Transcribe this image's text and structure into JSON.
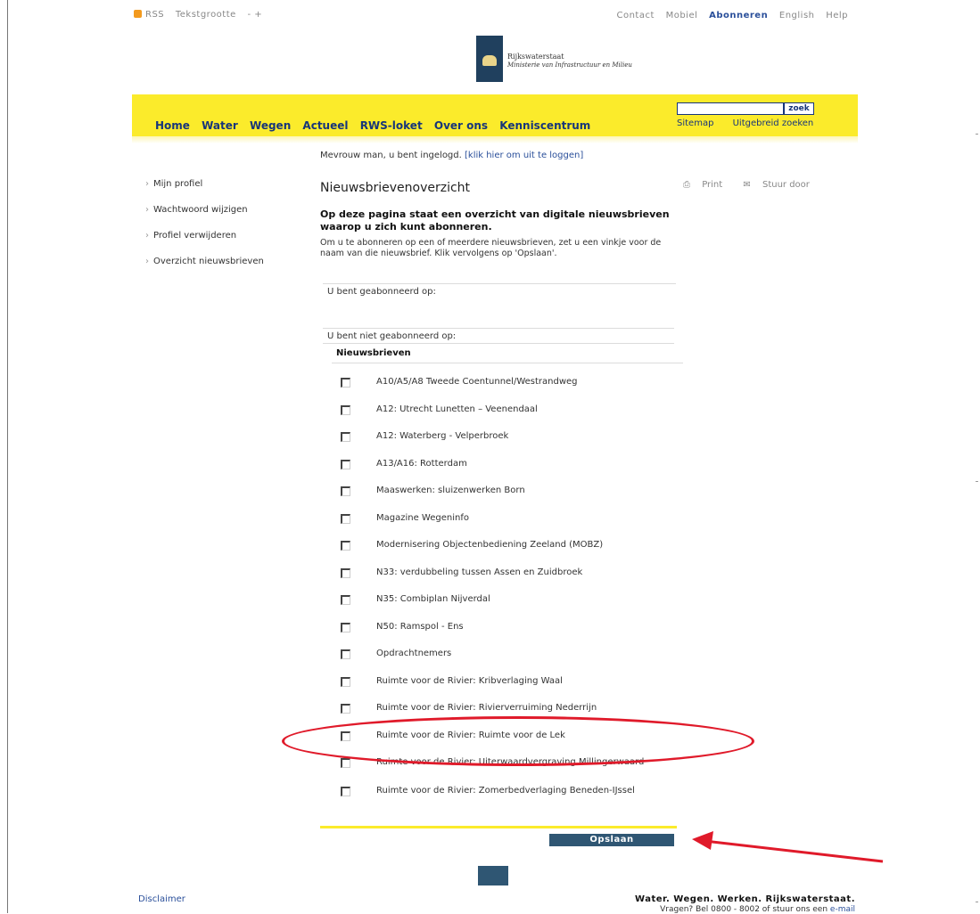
{
  "topbar": {
    "rss": "RSS",
    "text_size": "Tekstgrootte",
    "text_size_controls": "- +",
    "links": [
      "Contact",
      "Mobiel",
      "Abonneren",
      "English",
      "Help"
    ]
  },
  "logo": {
    "name": "Rijkswaterstaat",
    "ministry": "Ministerie van Infrastructuur en Milieu"
  },
  "nav": {
    "items": [
      "Home",
      "Water",
      "Wegen",
      "Actueel",
      "RWS-loket",
      "Over ons",
      "Kenniscentrum"
    ],
    "search_button": "zoek",
    "sitemap": "Sitemap",
    "advanced_search": "Uitgebreid zoeken"
  },
  "login": {
    "message": "Mevrouw man, u bent ingelogd.",
    "logout_link": "[klik hier om uit te loggen]"
  },
  "sidebar": {
    "items": [
      "Mijn profiel",
      "Wachtwoord wijzigen",
      "Profiel verwijderen",
      "Overzicht nieuwsbrieven"
    ]
  },
  "main": {
    "title": "Nieuwsbrievenoverzicht",
    "print": "Print",
    "forward": "Stuur door",
    "intro_bold": "Op deze pagina staat een overzicht van digitale nieuwsbrieven waarop u zich kunt abonneren.",
    "intro_text": "Om u te abonneren op een of meerdere nieuwsbrieven, zet u een vinkje voor de naam van die nieuwsbrief. Klik vervolgens op 'Opslaan'.",
    "subscribed_label": "U bent geabonneerd op:",
    "not_subscribed_label": "U bent niet geabonneerd op:",
    "column_header": "Nieuwsbrieven",
    "newsletters": [
      "A10/A5/A8  Tweede Coentunnel/Westrandweg",
      "A12: Utrecht Lunetten – Veenendaal",
      "A12: Waterberg - Velperbroek",
      "A13/A16: Rotterdam",
      "Maaswerken: sluizenwerken Born",
      "Magazine Wegeninfo",
      "Modernisering Objectenbediening Zeeland (MOBZ)",
      "N33: verdubbeling tussen Assen en Zuidbroek",
      "N35: Combiplan Nijverdal",
      "N50: Ramspol - Ens",
      "Opdrachtnemers",
      "Ruimte voor de Rivier: Kribverlaging Waal",
      "Ruimte voor de Rivier: Rivierverruiming Nederrijn",
      "Ruimte voor de Rivier: Ruimte voor de Lek",
      "Ruimte voor de Rivier: Uiterwaardvergraving Millingerwaard",
      "Ruimte voor de Rivier: Zomerbedverlaging Beneden-IJssel"
    ],
    "save_button": "Opslaan"
  },
  "footer": {
    "disclaimer": "Disclaimer",
    "slogan": "Water. Wegen. Werken. Rijkswaterstaat.",
    "contact_prefix": "Vragen? Bel 0800 - 8002 of stuur ons een",
    "contact_link": "e-mail"
  },
  "annotation_color": "#e01a2a",
  "brand_yellow": "#fbeb2b",
  "brand_blue": "#17357a"
}
